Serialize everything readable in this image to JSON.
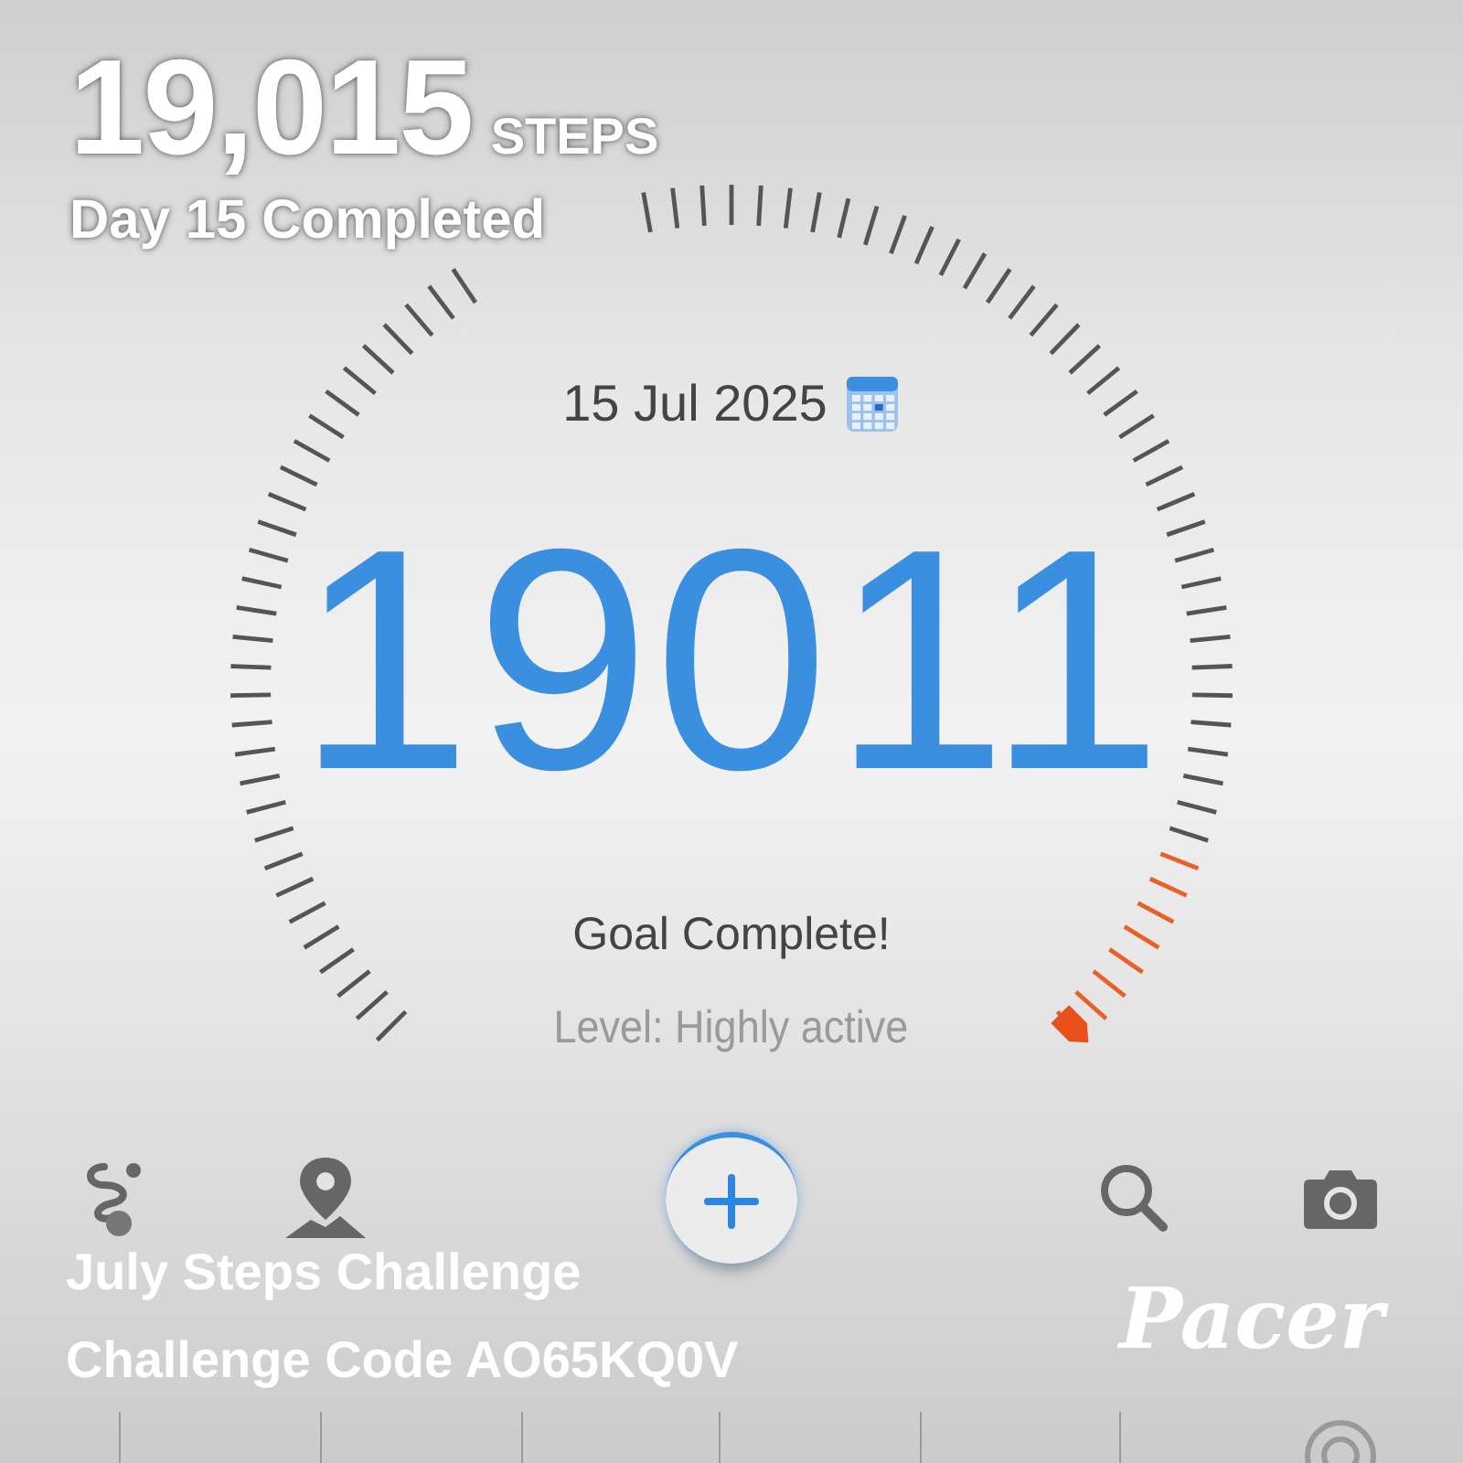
{
  "overlay": {
    "steps_total": "19,015",
    "steps_unit": "STEPS",
    "day_status": "Day 15 Completed",
    "challenge_name": "July Steps Challenge",
    "challenge_code": "Challenge Code AO65KQ0V",
    "logo": "Pacer"
  },
  "dial": {
    "date": "15 Jul 2025",
    "steps": "19011",
    "status": "Goal Complete!",
    "activity_level": "Level: Highly active"
  },
  "toolbar": [
    {
      "kind": "route"
    },
    {
      "kind": "map"
    },
    {
      "kind": "add"
    },
    {
      "kind": "search"
    },
    {
      "kind": "camera"
    }
  ]
}
